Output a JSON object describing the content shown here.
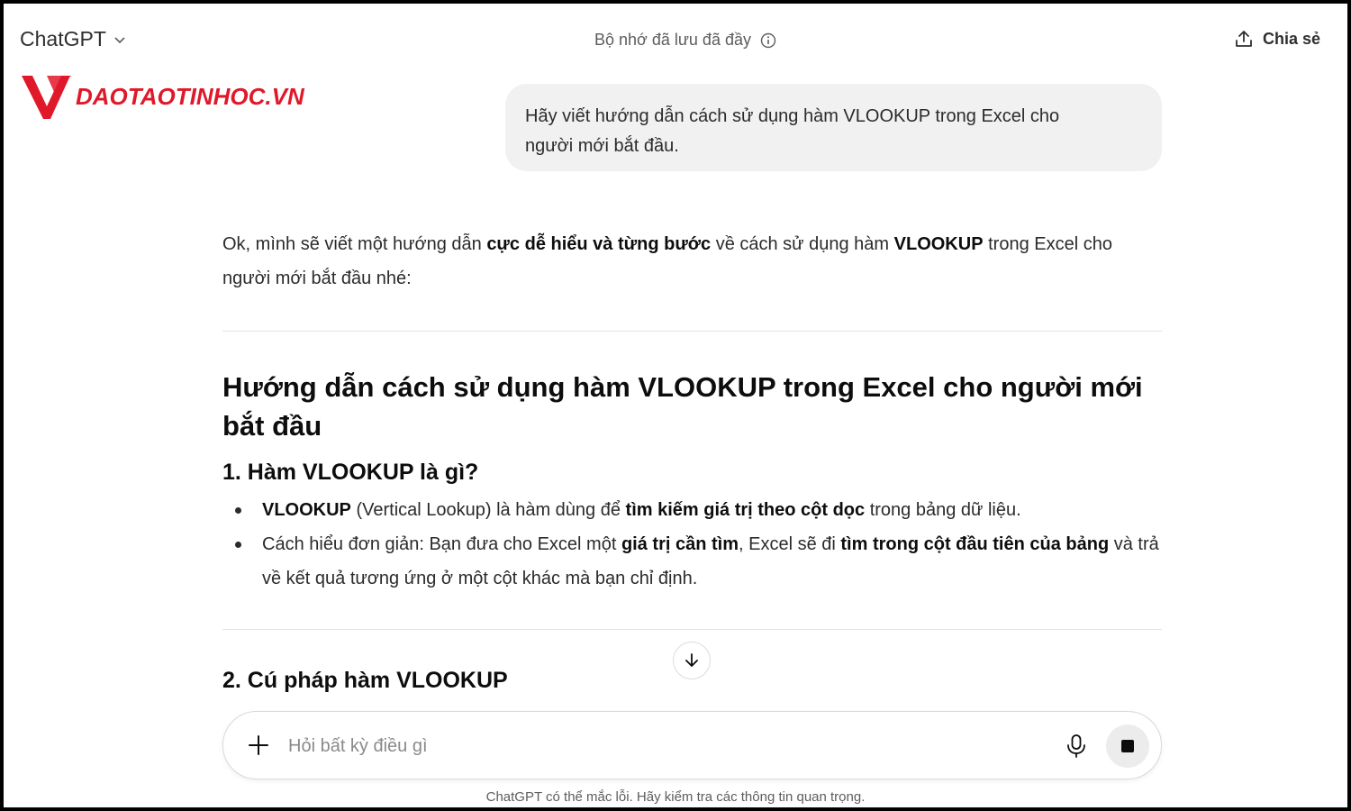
{
  "header": {
    "model_name": "ChatGPT",
    "memory_notice": "Bộ nhớ đã lưu đã đầy",
    "share_label": "Chia sẻ"
  },
  "watermark": {
    "brand_text": "DAOTAOTINHOC.VN",
    "brand_color": "#e0192a"
  },
  "conversation": {
    "user_message_line1": "Hãy viết hướng dẫn cách sử dụng hàm VLOOKUP trong Excel cho",
    "user_message_line2": "người mới bắt đầu.",
    "answer": {
      "intro": {
        "p1": "Ok, mình sẽ viết một hướng dẫn ",
        "b1": "cực dễ hiểu và từng bước",
        "p2": " về cách sử dụng hàm ",
        "b2": "VLOOKUP",
        "p3": " trong Excel cho người mới bắt đầu nhé:"
      },
      "title": "Hướng dẫn cách sử dụng hàm VLOOKUP trong Excel cho người mới bắt đầu",
      "section1": {
        "heading": "1. Hàm VLOOKUP là gì?",
        "bullet1": {
          "b1": "VLOOKUP",
          "p1": " (Vertical Lookup) là hàm dùng để ",
          "b2": "tìm kiếm giá trị theo cột dọc",
          "p2": " trong bảng dữ liệu."
        },
        "bullet2": {
          "p1": "Cách hiểu đơn giản: Bạn đưa cho Excel một ",
          "b1": "giá trị cần tìm",
          "p2": ", Excel sẽ đi ",
          "b2": "tìm trong cột đầu tiên của bảng",
          "p3": " và trả về kết quả tương ứng ở một cột khác mà bạn chỉ định."
        }
      },
      "section2": {
        "heading": "2. Cú pháp hàm VLOOKUP"
      }
    }
  },
  "composer": {
    "placeholder": "Hỏi bất kỳ điều gì"
  },
  "footer": {
    "disclaimer": "ChatGPT có thể mắc lỗi. Hãy kiểm tra các thông tin quan trọng."
  },
  "icons": {
    "model_dropdown": "chevron-down-icon",
    "memory_info": "info-icon",
    "share": "share-upload-icon",
    "scroll": "arrow-down-icon",
    "attach": "plus-icon",
    "voice": "microphone-icon",
    "stop": "stop-icon"
  }
}
